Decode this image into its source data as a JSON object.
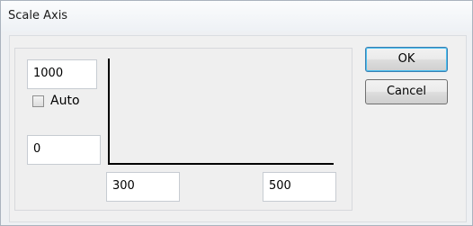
{
  "window": {
    "title": "Scale Axis"
  },
  "y_axis": {
    "max_value": "1000",
    "min_value": "0",
    "auto_label": "Auto",
    "auto_checked": false
  },
  "x_axis": {
    "min_value": "300",
    "max_value": "500"
  },
  "buttons": {
    "ok_label": "OK",
    "cancel_label": "Cancel"
  },
  "colors": {
    "ok_border": "#3c7fb1",
    "axis_line": "#000000"
  }
}
